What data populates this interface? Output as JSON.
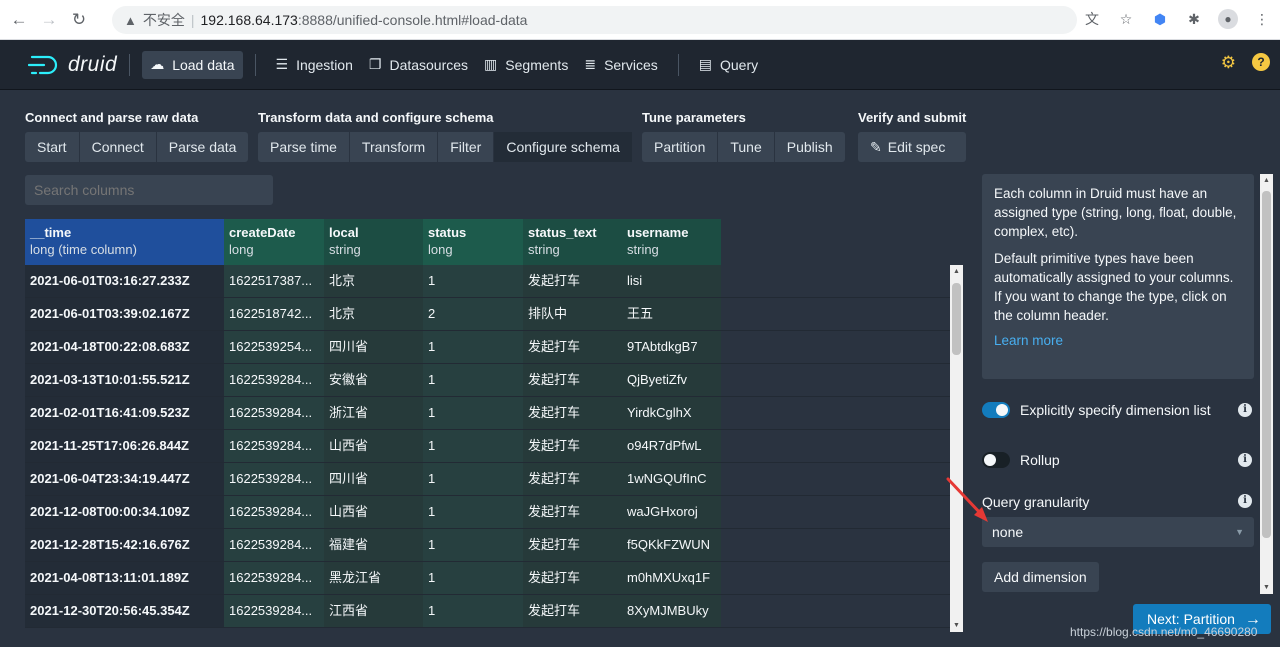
{
  "browser": {
    "security_label": "不安全",
    "url_host": "192.168.64.173",
    "url_rest": ":8888/unified-console.html#load-data"
  },
  "nav": {
    "logo_text": "druid",
    "load_data": "Load data",
    "ingestion": "Ingestion",
    "datasources": "Datasources",
    "segments": "Segments",
    "services": "Services",
    "query": "Query"
  },
  "steps": {
    "connect_title": "Connect and parse raw data",
    "connect_items": [
      "Start",
      "Connect",
      "Parse data"
    ],
    "transform_title": "Transform data and configure schema",
    "transform_items": [
      "Parse time",
      "Transform",
      "Filter",
      "Configure schema"
    ],
    "tune_title": "Tune parameters",
    "tune_items": [
      "Partition",
      "Tune",
      "Publish"
    ],
    "verify_title": "Verify and submit",
    "verify_items": [
      "Edit spec"
    ]
  },
  "search": {
    "placeholder": "Search columns"
  },
  "table": {
    "columns": [
      {
        "name": "__time",
        "type": "long (time column)"
      },
      {
        "name": "createDate",
        "type": "long"
      },
      {
        "name": "local",
        "type": "string"
      },
      {
        "name": "status",
        "type": "long"
      },
      {
        "name": "status_text",
        "type": "string"
      },
      {
        "name": "username",
        "type": "string"
      }
    ],
    "rows": [
      [
        "2021-06-01T03:16:27.233Z",
        "1622517387...",
        "北京",
        "1",
        "发起打车",
        "lisi"
      ],
      [
        "2021-06-01T03:39:02.167Z",
        "1622518742...",
        "北京",
        "2",
        "排队中",
        "王五"
      ],
      [
        "2021-04-18T00:22:08.683Z",
        "1622539254...",
        "四川省",
        "1",
        "发起打车",
        "9TAbtdkgB7"
      ],
      [
        "2021-03-13T10:01:55.521Z",
        "1622539284...",
        "安徽省",
        "1",
        "发起打车",
        "QjByetiZfv"
      ],
      [
        "2021-02-01T16:41:09.523Z",
        "1622539284...",
        "浙江省",
        "1",
        "发起打车",
        "YirdkCglhX"
      ],
      [
        "2021-11-25T17:06:26.844Z",
        "1622539284...",
        "山西省",
        "1",
        "发起打车",
        "o94R7dPfwL"
      ],
      [
        "2021-06-04T23:34:19.447Z",
        "1622539284...",
        "四川省",
        "1",
        "发起打车",
        "1wNGQUfInC"
      ],
      [
        "2021-12-08T00:00:34.109Z",
        "1622539284...",
        "山西省",
        "1",
        "发起打车",
        "waJGHxoroj"
      ],
      [
        "2021-12-28T15:42:16.676Z",
        "1622539284...",
        "福建省",
        "1",
        "发起打车",
        "f5QKkFZWUN"
      ],
      [
        "2021-04-08T13:11:01.189Z",
        "1622539284...",
        "黑龙江省",
        "1",
        "发起打车",
        "m0hMXUxq1F"
      ],
      [
        "2021-12-30T20:56:45.354Z",
        "1622539284...",
        "江西省",
        "1",
        "发起打车",
        "8XyMJMBUky"
      ]
    ]
  },
  "panel": {
    "callout_p1": "Each column in Druid must have an assigned type (string, long, float, double, complex, etc).",
    "callout_p2": "Default primitive types have been automatically assigned to your columns. If you want to change the type, click on the column header.",
    "learn_more": "Learn more",
    "explicit_dims_label": "Explicitly specify dimension list",
    "explicit_dims_on": true,
    "rollup_label": "Rollup",
    "rollup_on": false,
    "query_granularity_label": "Query granularity",
    "query_granularity_value": "none",
    "add_dimension": "Add dimension"
  },
  "next_button": "Next: Partition",
  "watermark": "https://blog.csdn.net/m0_46690280"
}
